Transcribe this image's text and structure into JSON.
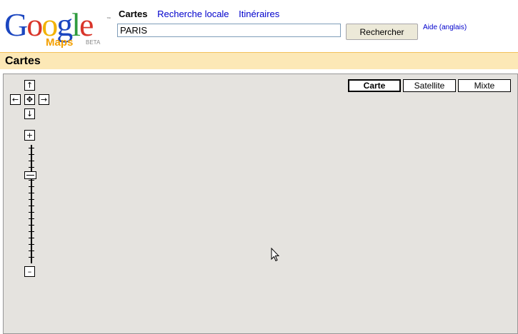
{
  "logo": {
    "letters": [
      "G",
      "o",
      "o",
      "g",
      "l",
      "e"
    ],
    "letter_colors": [
      "#1b46c0",
      "#d9352a",
      "#f2b200",
      "#1b46c0",
      "#2f9b3e",
      "#d9352a"
    ],
    "subtitle": "Maps",
    "beta": "BETA",
    "tm": "™"
  },
  "nav": {
    "active": "Cartes",
    "links": [
      "Recherche locale",
      "Itinéraires"
    ]
  },
  "search": {
    "value": "PARIS",
    "button": "Rechercher",
    "help": "Aide (anglais)"
  },
  "titlebar": {
    "title": "Cartes"
  },
  "map": {
    "controls": {
      "up": "↑",
      "down": "↓",
      "left": "←",
      "right": "→",
      "center": "✥",
      "zoom_in": "+",
      "zoom_out": "–"
    },
    "zoom_level_fraction": 0.25,
    "types": [
      {
        "label": "Carte",
        "selected": true
      },
      {
        "label": "Satellite",
        "selected": false
      },
      {
        "label": "Mixte",
        "selected": false
      }
    ],
    "background": "#e5e3df"
  }
}
